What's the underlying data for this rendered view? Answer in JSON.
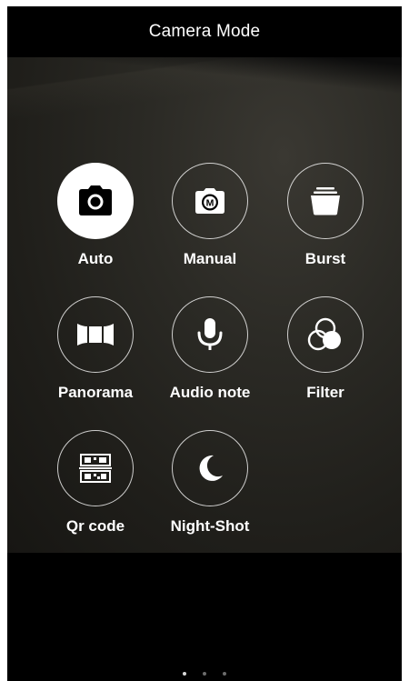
{
  "header": {
    "title": "Camera Mode"
  },
  "modes": [
    {
      "label": "Auto",
      "icon": "camera-icon",
      "active": true
    },
    {
      "label": "Manual",
      "icon": "manual-camera-icon",
      "active": false
    },
    {
      "label": "Burst",
      "icon": "burst-stack-icon",
      "active": false
    },
    {
      "label": "Panorama",
      "icon": "panorama-icon",
      "active": false
    },
    {
      "label": "Audio note",
      "icon": "microphone-icon",
      "active": false
    },
    {
      "label": "Filter",
      "icon": "filter-circles-icon",
      "active": false
    },
    {
      "label": "Qr code",
      "icon": "qr-code-icon",
      "active": false
    },
    {
      "label": "Night-Shot",
      "icon": "moon-icon",
      "active": false
    }
  ],
  "pager": {
    "pages": 3,
    "current_page": 1
  },
  "colors": {
    "background": "#000000",
    "icon": "#ffffff",
    "active_circle": "#ffffff",
    "active_icon": "#000000"
  }
}
